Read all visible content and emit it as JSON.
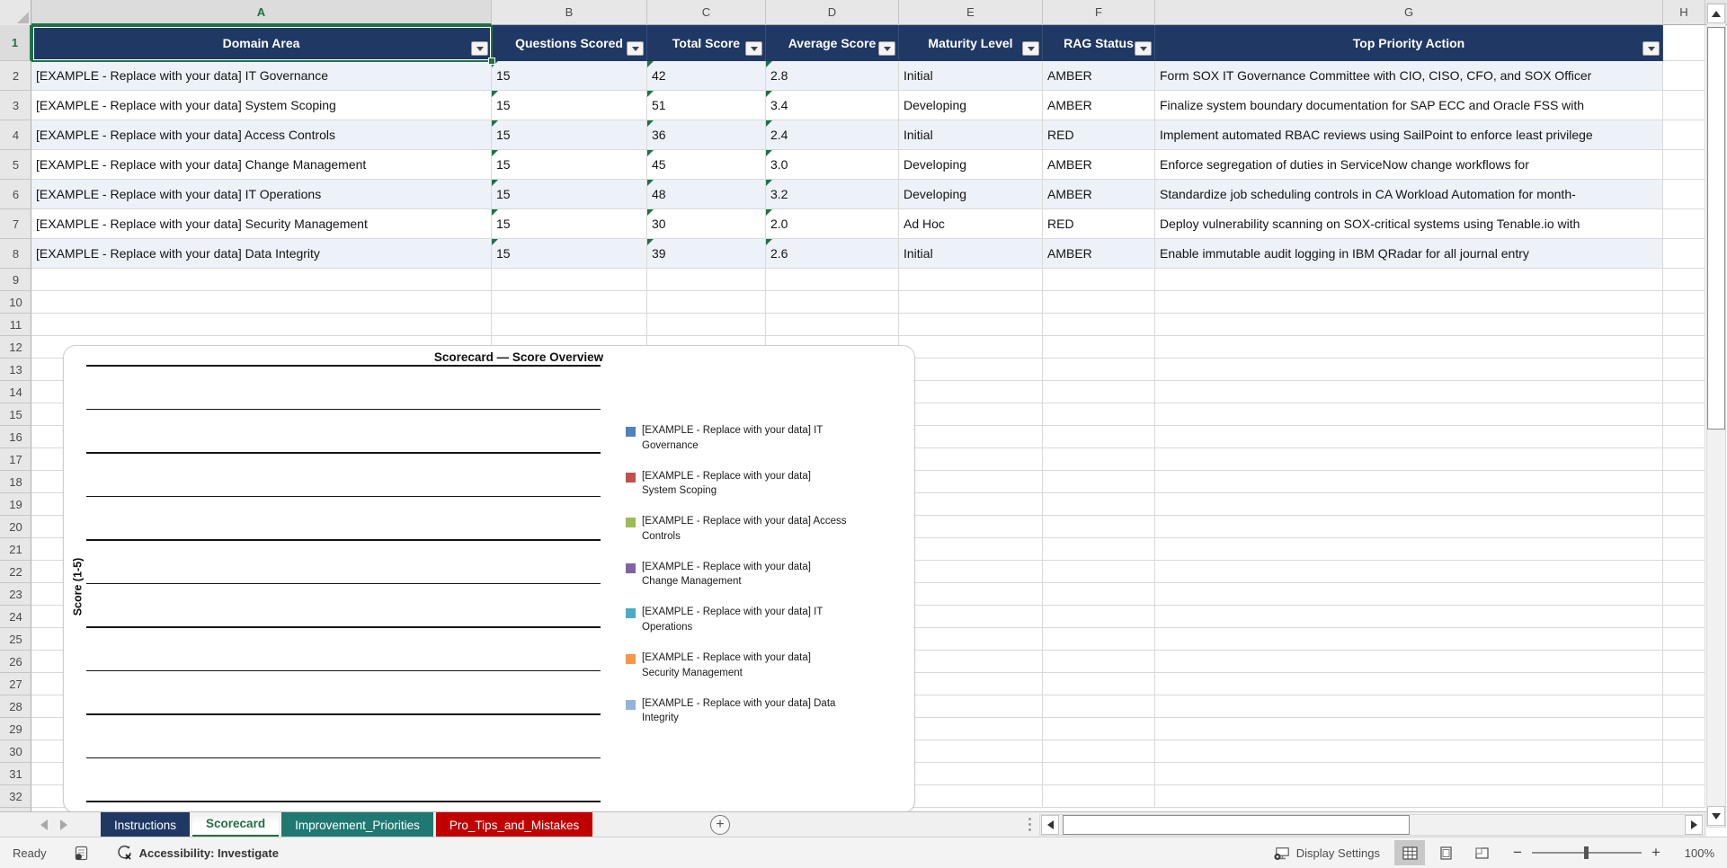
{
  "selection": {
    "active_cell": "A1",
    "active_column": "A",
    "active_row": "1"
  },
  "sheet": {
    "column_letters": [
      "A",
      "B",
      "C",
      "D",
      "E",
      "F",
      "G",
      "H"
    ],
    "row_count": 32,
    "table": {
      "headers": [
        "Domain Area",
        "Questions Scored",
        "Total Score",
        "Average Score",
        "Maturity Level",
        "RAG Status",
        "Top Priority Action"
      ],
      "rows": [
        [
          "[EXAMPLE - Replace with your data] IT Governance",
          "15",
          "42",
          "2.8",
          "Initial",
          "AMBER",
          "Form SOX IT Governance Committee with CIO, CISO, CFO, and SOX Officer"
        ],
        [
          "[EXAMPLE - Replace with your data] System Scoping",
          "15",
          "51",
          "3.4",
          "Developing",
          "AMBER",
          "Finalize system boundary documentation for SAP ECC and Oracle FSS with"
        ],
        [
          "[EXAMPLE - Replace with your data] Access Controls",
          "15",
          "36",
          "2.4",
          "Initial",
          "RED",
          "Implement automated RBAC reviews using SailPoint to enforce least privilege"
        ],
        [
          "[EXAMPLE - Replace with your data] Change Management",
          "15",
          "45",
          "3.0",
          "Developing",
          "AMBER",
          "Enforce segregation of duties in ServiceNow change workflows for"
        ],
        [
          "[EXAMPLE - Replace with your data] IT Operations",
          "15",
          "48",
          "3.2",
          "Developing",
          "AMBER",
          "Standardize job scheduling controls in CA Workload Automation for month-"
        ],
        [
          "[EXAMPLE - Replace with your data] Security Management",
          "15",
          "30",
          "2.0",
          "Ad Hoc",
          "RED",
          "Deploy vulnerability scanning on SOX-critical systems using Tenable.io with"
        ],
        [
          "[EXAMPLE - Replace with your data] Data Integrity",
          "15",
          "39",
          "2.6",
          "Initial",
          "AMBER",
          "Enable immutable audit logging in IBM QRadar for all journal entry"
        ]
      ],
      "error_flag_columns": [
        1,
        2,
        3
      ],
      "header_bg": "#1F3864",
      "banded_row_bg": "#EDF2F9"
    }
  },
  "chart": {
    "title": "Scorecard — Score Overview",
    "y_axis_title": "Score (1-5)",
    "legend": [
      {
        "color": "#4F81BD",
        "text": "[EXAMPLE - Replace with your data] IT\nGovernance"
      },
      {
        "color": "#C0504D",
        "text": "[EXAMPLE - Replace with your data]\nSystem Scoping"
      },
      {
        "color": "#9BBB59",
        "text": "[EXAMPLE - Replace with your data] Access\nControls"
      },
      {
        "color": "#8064A2",
        "text": "[EXAMPLE - Replace with your data]\nChange Management"
      },
      {
        "color": "#4BACC6",
        "text": "[EXAMPLE - Replace with your data] IT\nOperations"
      },
      {
        "color": "#F79646",
        "text": "[EXAMPLE - Replace with your data]\nSecurity Management"
      },
      {
        "color": "#95B3D7",
        "text": "[EXAMPLE - Replace with your data] Data\nIntegrity"
      }
    ]
  },
  "chart_data": {
    "type": "bar",
    "title": "Scorecard — Score Overview",
    "ylabel": "Score (1-5)",
    "ylim": [
      0,
      5
    ],
    "legend_position": "right",
    "gridlines": 11,
    "plot_area_empty": true,
    "series": [
      {
        "name": "[EXAMPLE - Replace with your data] IT Governance",
        "color": "#4F81BD"
      },
      {
        "name": "[EXAMPLE - Replace with your data] System Scoping",
        "color": "#C0504D"
      },
      {
        "name": "[EXAMPLE - Replace with your data] Access Controls",
        "color": "#9BBB59"
      },
      {
        "name": "[EXAMPLE - Replace with your data] Change Management",
        "color": "#8064A2"
      },
      {
        "name": "[EXAMPLE - Replace with your data] IT Operations",
        "color": "#4BACC6"
      },
      {
        "name": "[EXAMPLE - Replace with your data] Security Management",
        "color": "#F79646"
      },
      {
        "name": "[EXAMPLE - Replace with your data] Data Integrity",
        "color": "#95B3D7"
      }
    ]
  },
  "tabs": {
    "items": [
      {
        "label": "Instructions",
        "bg": "#1F3864",
        "fg": "#FFFFFF",
        "active": false
      },
      {
        "label": "Scorecard",
        "bg": "#FFFFFF",
        "fg": "#1E7145",
        "active": true
      },
      {
        "label": "Improvement_Priorities",
        "bg": "#1F7872",
        "fg": "#FFFFFF",
        "active": false
      },
      {
        "label": "Pro_Tips_and_Mistakes",
        "bg": "#C00000",
        "fg": "#FFFFFF",
        "active": false
      }
    ],
    "add_sheet_glyph": "+"
  },
  "status_bar": {
    "ready": "Ready",
    "accessibility": "Accessibility: Investigate",
    "display_settings": "Display Settings",
    "zoom_level": "100%"
  },
  "icons": {
    "filter_dropdown": "▼",
    "scroll_up": "▲",
    "scroll_down": "▼",
    "scroll_left": "◄",
    "scroll_right": "►",
    "tab_scroll_left": "◄",
    "tab_scroll_right": "►",
    "new_sheet": "+",
    "zoom_out": "−",
    "zoom_in": "+"
  },
  "colors": {
    "selection_green": "#1E7145",
    "header_navy": "#1F3864",
    "tab_teal": "#1F7872",
    "tab_red": "#C00000"
  }
}
